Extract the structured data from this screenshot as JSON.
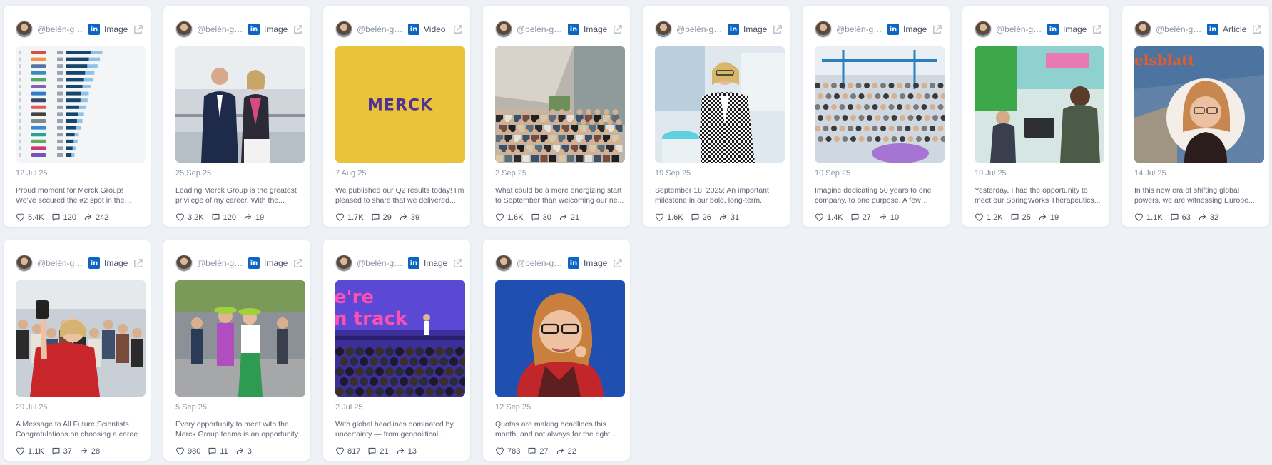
{
  "posts": [
    {
      "handle": "@belén-gar...",
      "type": "Image",
      "date": "12 Jul 25",
      "text": "Proud moment for Merck Group! We've secured the #2 spot in the Pharma AI...",
      "likes": "5.4K",
      "comments": "120",
      "shares": "242",
      "thumb": "ranking-chart"
    },
    {
      "handle": "@belén-gar...",
      "type": "Image",
      "date": "25 Sep 25",
      "text": "Leading Merck Group is the greatest privilege of my career. With the...",
      "likes": "3.2K",
      "comments": "120",
      "shares": "19",
      "thumb": "two-people-office"
    },
    {
      "handle": "@belén-gar...",
      "type": "Video",
      "date": "7 Aug 25",
      "text": "We published our Q2 results today! I'm pleased to share that we delivered...",
      "likes": "1.7K",
      "comments": "29",
      "shares": "39",
      "thumb": "merck-logo",
      "logo_text": "MERCK"
    },
    {
      "handle": "@belén-gar...",
      "type": "Image",
      "date": "2 Sep 25",
      "text": "What could be a more energizing start to September than welcoming our ne...",
      "likes": "1.6K",
      "comments": "30",
      "shares": "21",
      "thumb": "group-atrium"
    },
    {
      "handle": "@belén-gar...",
      "type": "Image",
      "date": "19 Sep 25",
      "text": "September 18, 2025: An important milestone in our bold, long-term...",
      "likes": "1.6K",
      "comments": "26",
      "shares": "31",
      "thumb": "woman-houndstooth"
    },
    {
      "handle": "@belén-gar...",
      "type": "Image",
      "date": "10 Sep 25",
      "text": "Imagine dedicating 50 years to one company, to one purpose. A few days...",
      "likes": "1.4K",
      "comments": "27",
      "shares": "10",
      "thumb": "event-hall"
    },
    {
      "handle": "@belén-gar...",
      "type": "Image",
      "date": "10 Jul 25",
      "text": "Yesterday, I had the opportunity to meet our SpringWorks Therapeutics...",
      "likes": "1.2K",
      "comments": "25",
      "shares": "19",
      "thumb": "office-meeting"
    },
    {
      "handle": "@belén-gar...",
      "type": "Article",
      "date": "14 Jul 25",
      "text": "In this new era of shifting global powers, we are witnessing Europe...",
      "likes": "1.1K",
      "comments": "63",
      "shares": "32",
      "thumb": "article-portrait",
      "logo_text": "elsblatt"
    },
    {
      "handle": "@belén-gar...",
      "type": "Image",
      "date": "29 Jul 25",
      "text": "A Message to All Future Scientists Congratulations on choosing a caree...",
      "likes": "1.1K",
      "comments": "37",
      "shares": "28",
      "thumb": "selfie-crowd"
    },
    {
      "handle": "@belén-gar...",
      "type": "Image",
      "date": "5 Sep 25",
      "text": "Every opportunity to meet with the Merck Group teams is an opportunity...",
      "likes": "980",
      "comments": "11",
      "shares": "3",
      "thumb": "street-party"
    },
    {
      "handle": "@belén-gar...",
      "type": "Image",
      "date": "2 Jul 25",
      "text": "With global headlines dominated by uncertainty — from geopolitical...",
      "likes": "817",
      "comments": "21",
      "shares": "13",
      "thumb": "stage-track",
      "logo_text": "e're n track"
    },
    {
      "handle": "@belén-gar...",
      "type": "Image",
      "date": "12 Sep 25",
      "text": "Quotas are making headlines this month, and not always for the right...",
      "likes": "783",
      "comments": "27",
      "shares": "22",
      "thumb": "portrait-blue"
    }
  ],
  "colors": {
    "linkedin": "#0a66c2",
    "background": "#eef1f6",
    "card": "#ffffff"
  },
  "icons": {
    "network": "linkedin-icon",
    "open": "external-link-icon",
    "likes": "heart-icon",
    "comments": "comment-icon",
    "shares": "share-icon"
  }
}
